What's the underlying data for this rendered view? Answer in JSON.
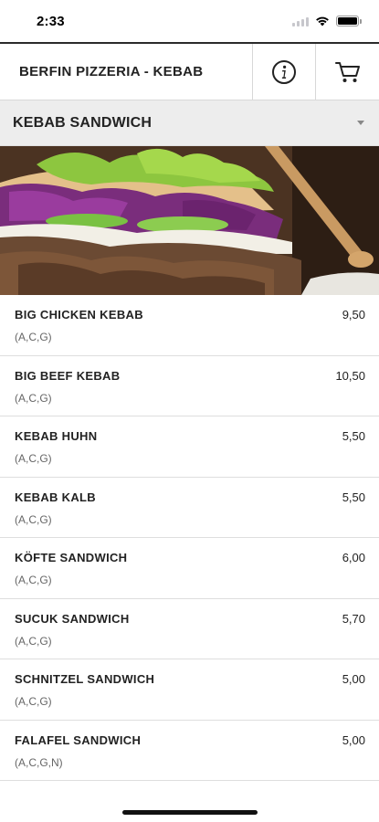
{
  "status": {
    "time": "2:33"
  },
  "header": {
    "title": "BERFIN PIZZERIA - KEBAB",
    "info_icon": "info-icon",
    "cart_icon": "cart-icon"
  },
  "category": {
    "label": "KEBAB SANDWICH"
  },
  "menu": {
    "items": [
      {
        "name": "BIG CHICKEN KEBAB",
        "price": "9,50",
        "allergens": "(A,C,G)"
      },
      {
        "name": "BIG BEEF KEBAB",
        "price": "10,50",
        "allergens": "(A,C,G)"
      },
      {
        "name": "KEBAB HUHN",
        "price": "5,50",
        "allergens": "(A,C,G)"
      },
      {
        "name": "KEBAB KALB",
        "price": "5,50",
        "allergens": "(A,C,G)"
      },
      {
        "name": "KÖFTE SANDWICH",
        "price": "6,00",
        "allergens": "(A,C,G)"
      },
      {
        "name": "SUCUK SANDWICH",
        "price": "5,70",
        "allergens": "(A,C,G)"
      },
      {
        "name": "SCHNITZEL SANDWICH",
        "price": "5,00",
        "allergens": "(A,C,G)"
      },
      {
        "name": "FALAFEL SANDWICH",
        "price": "5,00",
        "allergens": "(A,C,G,N)"
      }
    ]
  }
}
